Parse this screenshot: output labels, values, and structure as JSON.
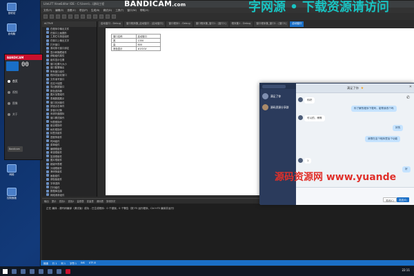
{
  "ide": {
    "title": "LiteLFT ViewEditor IDE - C:\\Users\\...\\源码工程",
    "menus": [
      "文件(F)",
      "编辑(E)",
      "查看(V)",
      "项目(P)",
      "生成(B)",
      "调试(D)",
      "工具(T)",
      "窗口(W)",
      "帮助(H)"
    ],
    "tabs": [
      "启动窗口 - Debug",
      "窗口程序集_启动窗口 - [启动窗口]",
      "窗口程序1 - Debug",
      "窗口程序集_窗口1 - [窗口1]",
      "程序集1 - Debug",
      "窗口程序集_窗口1 - [窗口1]",
      "启动窗口"
    ],
    "active_tab_index": 6,
    "tree_header": "ACTIVE",
    "tree_items": [
      "在程序中输出文件",
      "在窗口上画图形",
      "工具栏与按钮组件",
      "在窗口上输出文字",
      "打开窗口",
      "滚动条与窗口绑定",
      "显示和隐藏组件",
      "获取组件属性",
      "组件显示位置",
      "窗口位置与大小",
      "窗口配置输出",
      "所有窗口组件",
      "程序初始化窗口",
      "文件读写窗口",
      "自定义绘图",
      "导出数据窗口",
      "颜色选择器",
      "图片加载组件",
      "表格数据展示",
      "窗口关闭事件",
      "按钮点击事件",
      "多窗口切换",
      "系统托盘图标",
      "窗口置顶操作",
      "列表框操作",
      "组合框操作",
      "树形框操作",
      "标签页组件",
      "进度条组件",
      "时间组件",
      "菜单组件",
      "编辑框组件",
      "单选框组件",
      "复选框组件",
      "图片框组件",
      "超级列表框",
      "分组框组件",
      "滑块条组件",
      "画板组件",
      "调色板组件",
      "字体选择",
      "打印组件",
      "数据库连接",
      "网络请求组件",
      "线程操作",
      "定时器组件",
      "剪贴板操作",
      "注册表操作",
      "文件夹选择",
      "窗口属性设置"
    ],
    "form_table": [
      [
        "窗口名称",
        "启动窗口"
      ],
      [
        "宽",
        "1350"
      ],
      [
        "高",
        "800"
      ],
      [
        "底色显示",
        "#1f1f1f"
      ]
    ],
    "output_tabs": [
      "输出",
      "提示",
      "查找1",
      "查找2",
      "监视表",
      "变量表",
      "调用表",
      "剪辑历史"
    ],
    "output_text": "正在 编译 - 源代码编译（调试版）成功 - 已生成程序：0 个错误，0 个警告（按 F5 运行程序，Ctrl+F5 编译并运行）",
    "status_items": [
      "就绪",
      "行 1",
      "列 1",
      "字符 1",
      "INS",
      "UTF-8"
    ]
  },
  "bandicam_overlay": {
    "brand": "BANDICAM",
    "url": ".com"
  },
  "bandicam_panel": {
    "title": "BANDICAM",
    "timer": "00",
    "nav": [
      "首页",
      "视频",
      "图像",
      "关于"
    ],
    "active_nav_index": 0,
    "footer": "Bandicam"
  },
  "chat": {
    "title": "满足了你",
    "contacts": [
      {
        "name": "满足了你"
      },
      {
        "name": "源码资源分享群"
      }
    ],
    "messages": [
      {
        "side": "left",
        "text": "你好"
      },
      {
        "side": "right",
        "text": "你了解的程序下载吗，能帮我改个吗"
      },
      {
        "side": "left",
        "text": "可以的，稍等"
      },
      {
        "side": "right",
        "text": "好的"
      },
      {
        "side": "right",
        "text": "我想在这个程序里加个功能"
      },
      {
        "side": "left",
        "text": "1"
      },
      {
        "side": "right",
        "text": "好"
      }
    ],
    "close_label": "关闭(C)",
    "send_label": "发送(S)"
  },
  "watermark": {
    "text": "源码资源网",
    "url": "www.yuande"
  },
  "taskbar": {
    "clock": "22:11"
  },
  "desktop_icons": [
    "回收站",
    "此电脑",
    "网络",
    "控制面板",
    "浏览器",
    "Bandicam"
  ]
}
